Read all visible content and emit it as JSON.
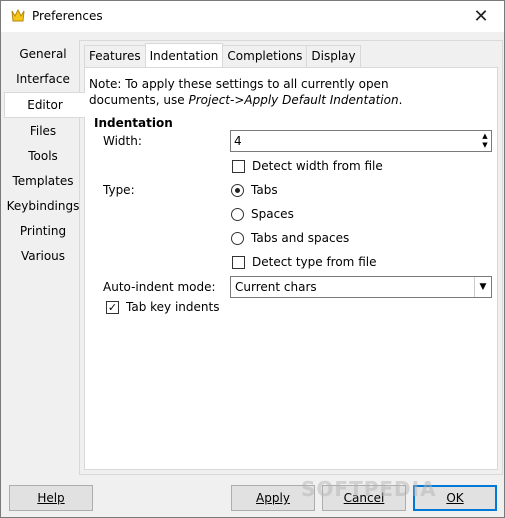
{
  "window": {
    "title": "Preferences",
    "close_glyph": "✕"
  },
  "sidebar": {
    "items": [
      {
        "label": "General"
      },
      {
        "label": "Interface"
      },
      {
        "label": "Editor"
      },
      {
        "label": "Files"
      },
      {
        "label": "Tools"
      },
      {
        "label": "Templates"
      },
      {
        "label": "Keybindings"
      },
      {
        "label": "Printing"
      },
      {
        "label": "Various"
      }
    ],
    "active": "Editor"
  },
  "tabs": {
    "items": [
      {
        "label": "Features"
      },
      {
        "label": "Indentation"
      },
      {
        "label": "Completions"
      },
      {
        "label": "Display"
      }
    ],
    "active": "Indentation"
  },
  "indentation": {
    "note_line1": "Note: To apply these settings to all currently open",
    "note_line2_prefix": "documents, use ",
    "note_line2_italic": "Project->Apply Default Indentation",
    "note_line2_suffix": ".",
    "section_title": "Indentation",
    "width_label": "Width:",
    "width_value": "4",
    "detect_width_label": "Detect width from file",
    "detect_width_checked": false,
    "type_label": "Type:",
    "type_options": [
      {
        "label": "Tabs",
        "selected": true
      },
      {
        "label": "Spaces",
        "selected": false
      },
      {
        "label": "Tabs and spaces",
        "selected": false
      }
    ],
    "detect_type_label": "Detect type from file",
    "detect_type_checked": false,
    "auto_indent_label": "Auto-indent mode:",
    "auto_indent_value": "Current chars",
    "tab_key_label": "Tab key indents",
    "tab_key_checked": true
  },
  "buttons": {
    "help": "Help",
    "apply": "Apply",
    "cancel": "Cancel",
    "ok": "OK"
  },
  "watermark": "SOFTPEDIA",
  "colors": {
    "accent": "#0078d7",
    "icon_yellow": "#f5c518"
  }
}
